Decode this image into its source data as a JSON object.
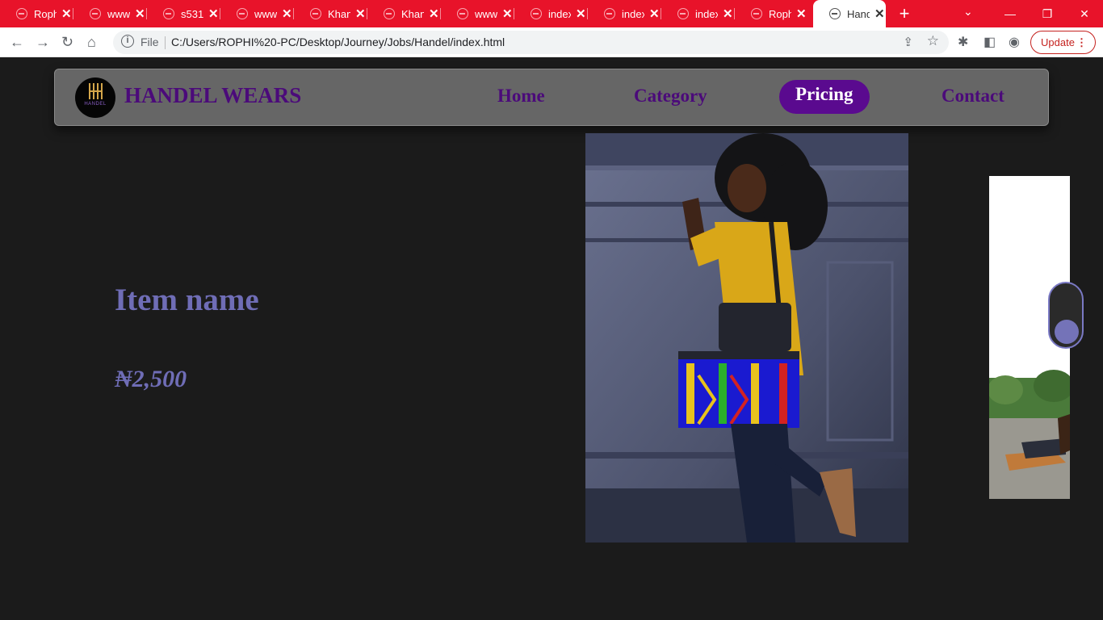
{
  "browser": {
    "tabs": [
      {
        "label": "Roph",
        "active": false
      },
      {
        "label": "www.",
        "active": false
      },
      {
        "label": "s531",
        "active": false
      },
      {
        "label": "www.",
        "active": false
      },
      {
        "label": "Khan",
        "active": false
      },
      {
        "label": "Khan",
        "active": false
      },
      {
        "label": "www.",
        "active": false
      },
      {
        "label": "index",
        "active": false
      },
      {
        "label": "index",
        "active": false
      },
      {
        "label": "index",
        "active": false
      },
      {
        "label": "Roph",
        "active": false
      },
      {
        "label": "Hand",
        "active": true
      }
    ],
    "new_tab_icon": "+",
    "address": {
      "scheme_label": "File",
      "url": "C:/Users/ROPHI%20-PC/Desktop/Journey/Jobs/Handel/index.html"
    },
    "update_label": "Update",
    "colors": {
      "tabbar": "#e8132a",
      "update": "#c5221f"
    }
  },
  "site": {
    "brand": "HANDEL WEARS",
    "logo_text": "HANDEL",
    "nav": [
      {
        "label": "Home",
        "active": false
      },
      {
        "label": "Category",
        "active": false
      },
      {
        "label": "Pricing",
        "active": true
      },
      {
        "label": "Contact",
        "active": false
      }
    ],
    "item": {
      "name": "Item name",
      "price": "₦2,500"
    },
    "colors": {
      "brand": "#4b0a7a",
      "active_nav": "#5a0a8f",
      "item_text": "#6f6db6",
      "background": "#1b1b1b"
    }
  }
}
